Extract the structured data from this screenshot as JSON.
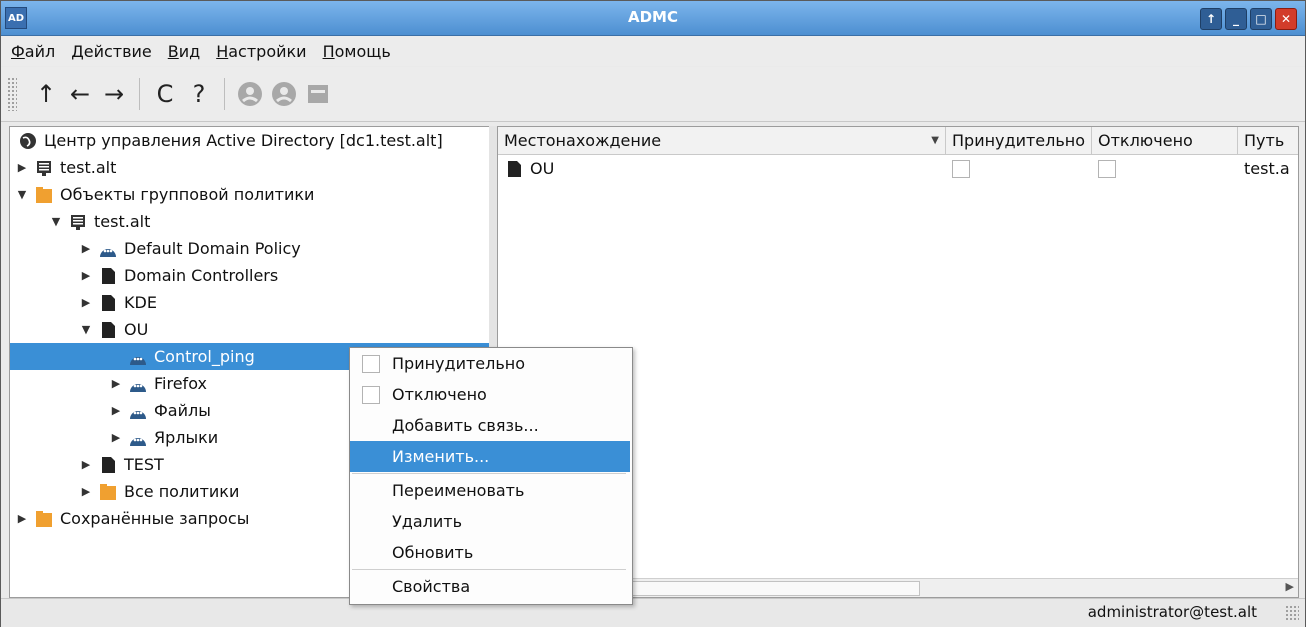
{
  "window": {
    "badge": "AD",
    "title": "ADMC",
    "buttons": [
      "↑",
      "_",
      "□",
      "✕"
    ]
  },
  "menubar": [
    {
      "first": "Ф",
      "rest": "айл"
    },
    {
      "first": "Д",
      "rest": "ействие"
    },
    {
      "first": "В",
      "rest": "ид"
    },
    {
      "first": "Н",
      "rest": "астройки"
    },
    {
      "first": "П",
      "rest": "омощь"
    }
  ],
  "toolbar": {
    "up": "↑",
    "back": "←",
    "forward": "→",
    "refresh": "C",
    "help": "?"
  },
  "tree": {
    "root": "Центр управления Active Directory [dc1.test.alt]",
    "items": [
      {
        "label": "test.alt",
        "icon": "server-icon"
      },
      {
        "label": "Объекты групповой политики",
        "icon": "folder-icon"
      },
      {
        "label": "test.alt",
        "icon": "server-icon"
      },
      {
        "label": "Default Domain Policy",
        "icon": "policy-icon"
      },
      {
        "label": "Domain Controllers",
        "icon": "ou-icon"
      },
      {
        "label": "KDE",
        "icon": "ou-icon"
      },
      {
        "label": "OU",
        "icon": "ou-icon"
      },
      {
        "label": "Control_ping",
        "icon": "policy-icon"
      },
      {
        "label": "Firefox",
        "icon": "policy-icon"
      },
      {
        "label": "Файлы",
        "icon": "policy-icon"
      },
      {
        "label": "Ярлыки",
        "icon": "policy-icon"
      },
      {
        "label": "TEST",
        "icon": "ou-icon"
      },
      {
        "label": "Все политики",
        "icon": "folder-icon"
      },
      {
        "label": "Сохранённые запросы",
        "icon": "folder-icon"
      }
    ]
  },
  "table": {
    "columns": [
      "Местонахождение",
      "Принудительно",
      "Отключено",
      "Путь"
    ],
    "rows": [
      {
        "location": "OU",
        "path": "test.a"
      }
    ]
  },
  "context_menu": {
    "items": [
      "Принудительно",
      "Отключено",
      "Добавить связь...",
      "Изменить...",
      "Переименовать",
      "Удалить",
      "Обновить",
      "Свойства"
    ]
  },
  "status": {
    "user": "administrator@test.alt"
  },
  "colors": {
    "selection": "#3a8fd6",
    "folder": "#f0a030",
    "policy": "#2d5a8a",
    "titlebar": "#5a9ad9"
  }
}
